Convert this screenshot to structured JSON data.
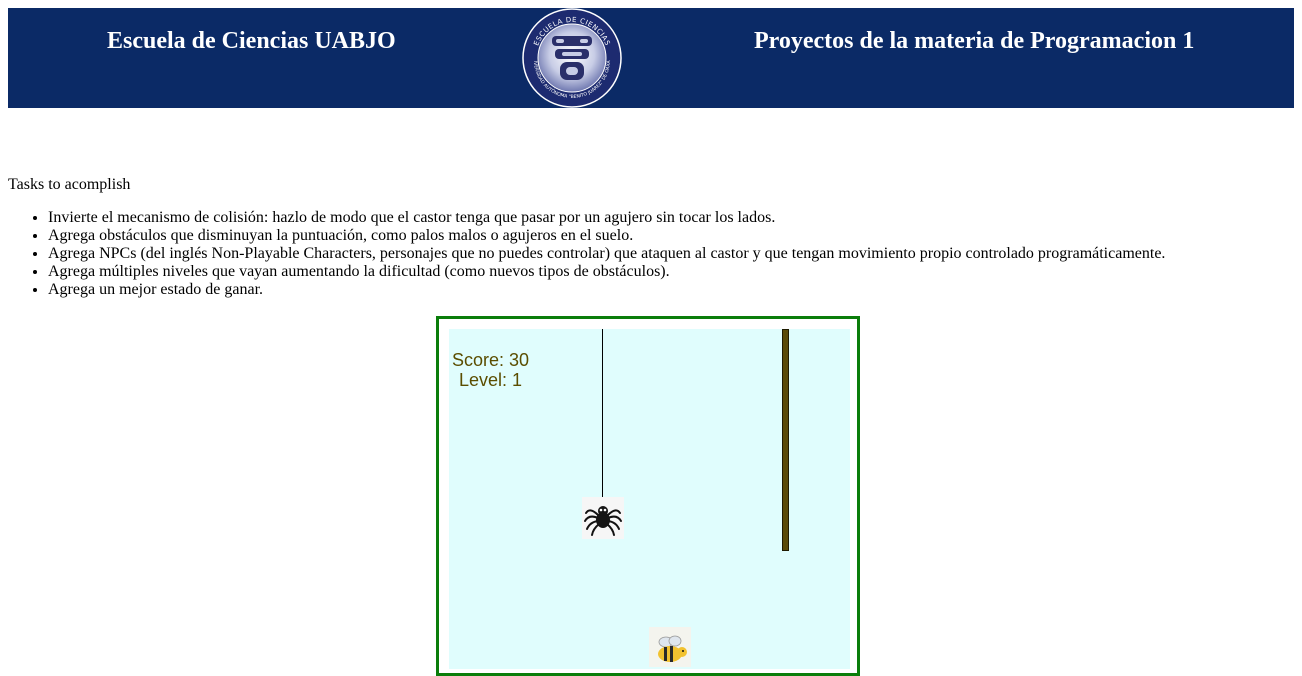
{
  "header": {
    "left_title": "Escuela de Ciencias UABJO",
    "right_title": "Proyectos de la materia de Programacion 1",
    "seal_text": "ESCUELA DE CIENCIAS · UNIVERSIDAD AUTÓNOMA \"BENITO JUÁREZ\" DE OAXACA",
    "bg_color": "#0b2a66"
  },
  "tasks": {
    "title": "Tasks to acomplish",
    "items": [
      "Invierte el mecanismo de colisión: hazlo de modo que el castor tenga que pasar por un agujero sin tocar los lados.",
      "Agrega obstáculos que disminuyan la puntuación, como palos malos o agujeros en el suelo.",
      "Agrega NPCs (del inglés Non-Playable Characters, personajes que no puedes controlar) que ataquen al castor y que tengan movimiento propio controlado programáticamente.",
      "Agrega múltiples niveles que vayan aumentando la dificultad (como nuevos tipos de obstáculos).",
      "Agrega un mejor estado de ganar."
    ]
  },
  "game": {
    "score_text": "Score: 30",
    "level_text": "Level: 1",
    "sprites": [
      "spider-icon",
      "bee-icon",
      "stick-obstacle"
    ],
    "frame_color": "#0a7d0a",
    "canvas_color": "#e0fdfd"
  }
}
